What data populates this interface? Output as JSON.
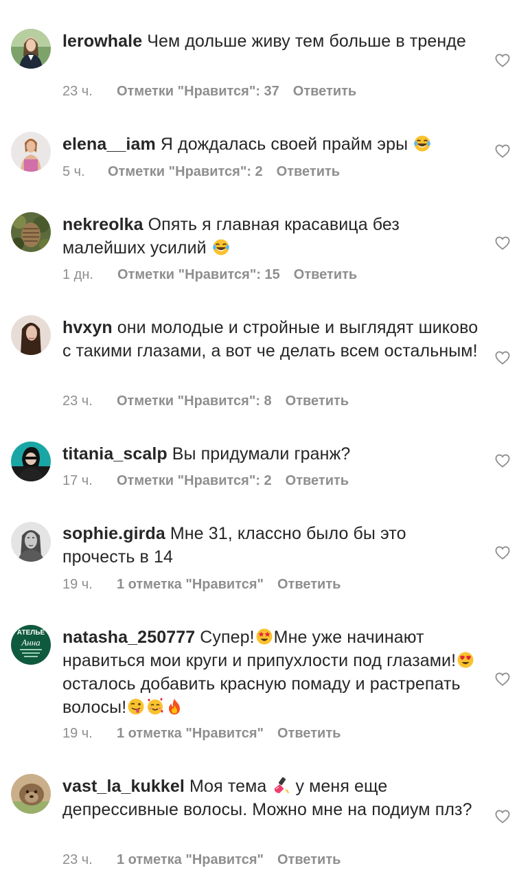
{
  "comments": [
    {
      "username": "lerowhale",
      "text": "Чем дольше живу тем больше в тренде",
      "time": "23 ч.",
      "likes": "Отметки \"Нравится\": 37",
      "reply": "Ответить"
    },
    {
      "username": "elena__iam",
      "text": "Я дождалась своей прайм эры",
      "time": "5 ч.",
      "likes": "Отметки \"Нравится\": 2",
      "reply": "Ответить"
    },
    {
      "username": "nekreolka",
      "text": "Опять я главная красавица без малейших усилий",
      "time": "1 дн.",
      "likes": "Отметки \"Нравится\": 15",
      "reply": "Ответить"
    },
    {
      "username": "hvxyn",
      "text": "они молодые и стройные и выглядят шиково с такими глазами, а вот че делать всем остальным!",
      "time": "23 ч.",
      "likes": "Отметки \"Нравится\": 8",
      "reply": "Ответить"
    },
    {
      "username": "titania_scalp",
      "text": "Вы придумали гранж?",
      "time": "17 ч.",
      "likes": "Отметки \"Нравится\": 2",
      "reply": "Ответить"
    },
    {
      "username": "sophie.girda",
      "text": "Мне 31, классно было бы это прочесть в 14",
      "time": "19 ч.",
      "likes": "1 отметка \"Нравится\"",
      "reply": "Ответить"
    },
    {
      "username": "natasha_250777",
      "text_parts": [
        "Супер!",
        "Мне уже начинают нравиться мои круги и припухлости под глазами!",
        "осталось добавить красную помаду и растрепать волосы!"
      ],
      "avatar_text": "АТЕЛЬЕ",
      "avatar_script": "Анна",
      "time": "19 ч.",
      "likes": "1 отметка \"Нравится\"",
      "reply": "Ответить"
    },
    {
      "username": "vast_la_kukkel",
      "text_parts": [
        "Моя тема",
        "у меня еще депрессивные волосы. Можно мне на подиум плз?"
      ],
      "time": "23 ч.",
      "likes": "1 отметка \"Нравится\"",
      "reply": "Ответить"
    }
  ],
  "icons": {
    "like": "heart-outline-icon",
    "emoji_laugh": "face-with-tears-of-joy",
    "emoji_star_eyes": "star-struck-face",
    "emoji_heart_eyes": "smiling-face-with-heart-eyes",
    "emoji_tongue": "winking-face-with-tongue",
    "emoji_hearts": "smiling-face-with-hearts",
    "emoji_fire": "fire",
    "emoji_nail_polish": "nail-polish"
  },
  "colors": {
    "text": "#262626",
    "meta": "#8e8e8e",
    "background": "#ffffff"
  }
}
